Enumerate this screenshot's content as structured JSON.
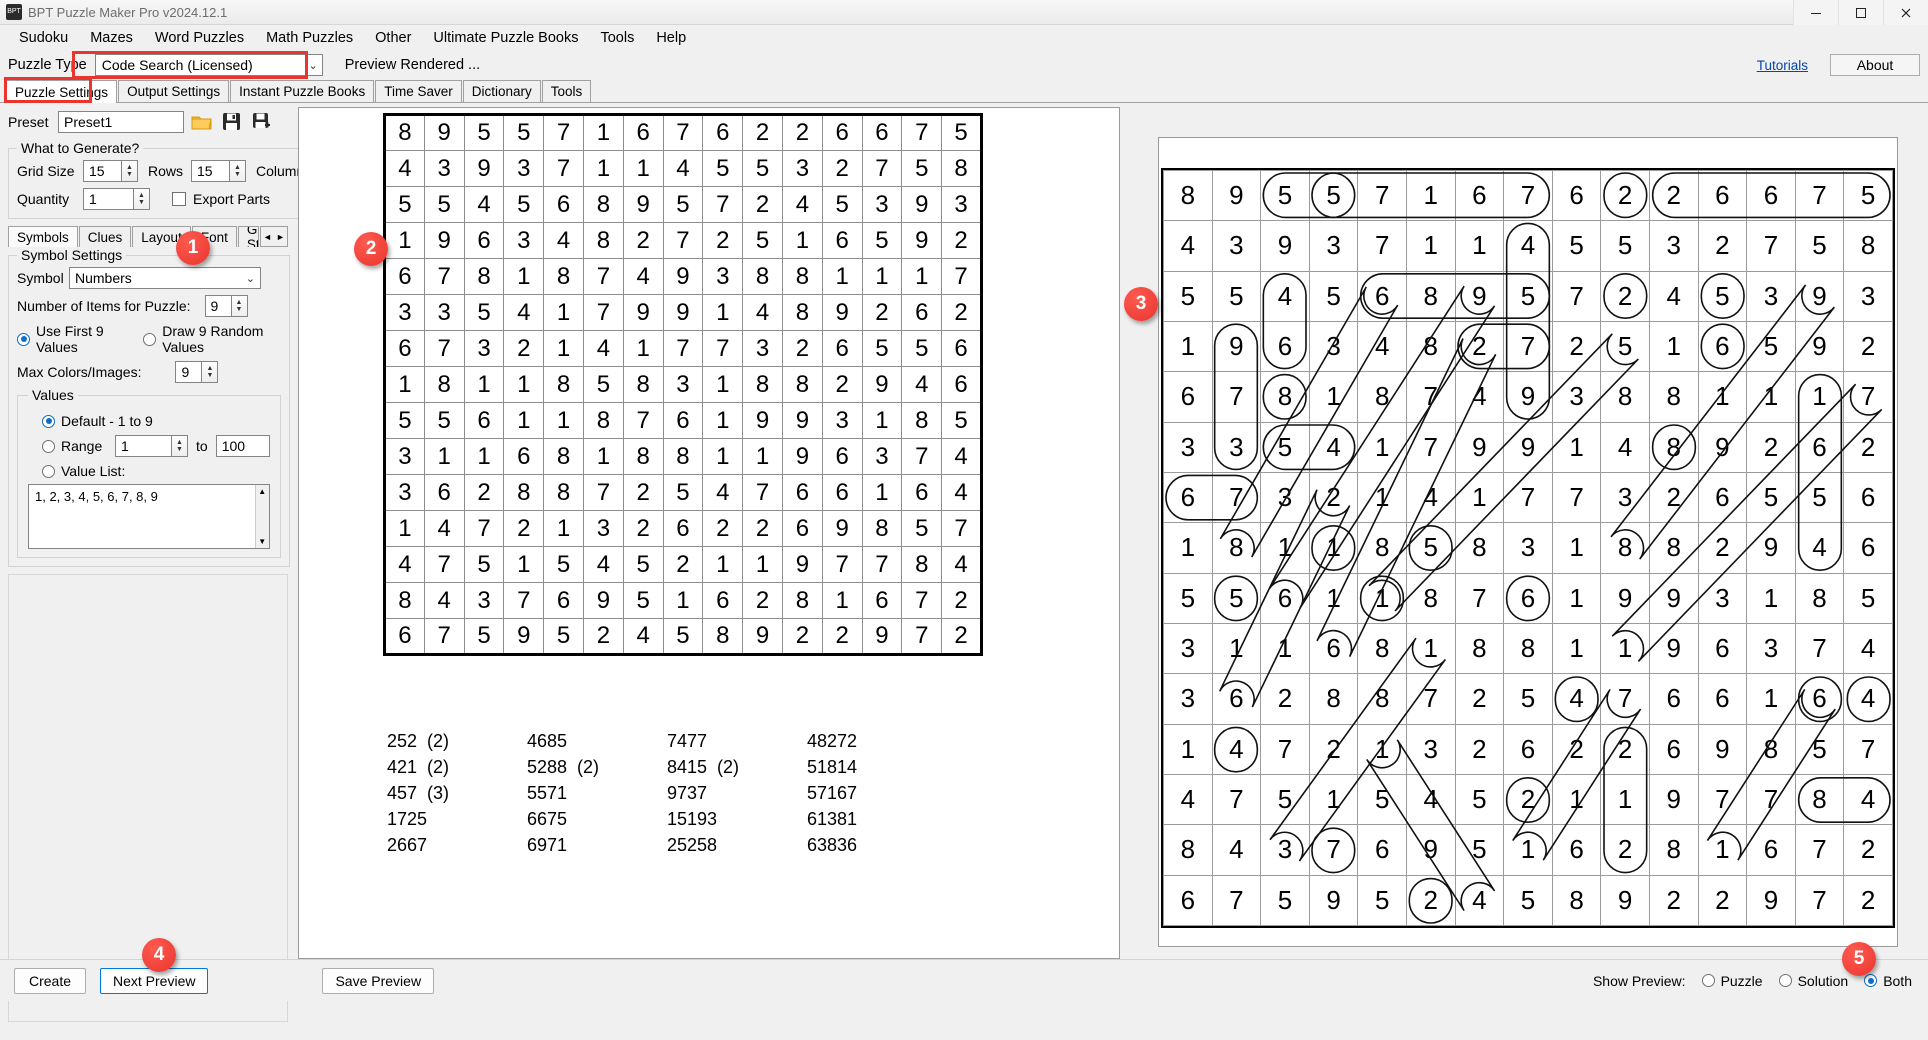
{
  "window": {
    "title": "BPT Puzzle Maker Pro v2024.12.1",
    "icon_label": "BPT",
    "buttons": {
      "minimize": "–",
      "maximize": "❐",
      "close": "✕"
    }
  },
  "menubar": {
    "items": [
      "Sudoku",
      "Mazes",
      "Word Puzzles",
      "Math Puzzles",
      "Other",
      "Ultimate Puzzle Books",
      "Tools",
      "Help"
    ]
  },
  "type_row": {
    "label": "Puzzle Type",
    "selected": "Code Search (Licensed)",
    "chevron": "⌄",
    "preview_rendered": "Preview Rendered ...",
    "tutorials": "Tutorials",
    "about": "About"
  },
  "tabs": {
    "items": [
      "Puzzle Settings",
      "Output Settings",
      "Instant Puzzle Books",
      "Time Saver",
      "Dictionary",
      "Tools"
    ],
    "active": "Puzzle Settings"
  },
  "settings": {
    "preset_label": "Preset",
    "preset_value": "Preset1",
    "icon_open": "open-folder-icon",
    "icon_save": "save-icon",
    "icon_save_as": "save-as-icon",
    "generate_legend": "What to Generate?",
    "grid_size_label": "Grid Size",
    "grid_size_value": "15",
    "rows_label": "Rows",
    "rows_value": "15",
    "columns_label": "Columns",
    "quantity_label": "Quantity",
    "quantity_value": "1",
    "export_parts_label": "Export Parts",
    "inner_tabs": [
      "Symbols",
      "Clues",
      "Layout",
      "Font",
      "Grid Styling"
    ],
    "inner_active": "Symbols",
    "scroll_left": "◄",
    "scroll_right": "►",
    "symbol_legend": "Symbol Settings",
    "symbol_label": "Symbol",
    "symbol_value": "Numbers",
    "items_label": "Number of Items for Puzzle:",
    "items_value": "9",
    "use_first_label": "Use First 9 Values",
    "draw_random_label": "Draw 9 Random Values",
    "max_colors_label": "Max Colors/Images:",
    "max_colors_value": "9",
    "values_legend": "Values",
    "default_label": "Default - 1 to 9",
    "range_label": "Range",
    "range_from": "1",
    "range_to_label": "to",
    "range_to": "100",
    "value_list_label": "Value List:",
    "value_list_value": "1, 2, 3, 4, 5, 6, 7, 8, 9"
  },
  "puzzle": {
    "grid": [
      [
        "8",
        "9",
        "5",
        "5",
        "7",
        "1",
        "6",
        "7",
        "6",
        "2",
        "2",
        "6",
        "6",
        "7",
        "5"
      ],
      [
        "4",
        "3",
        "9",
        "3",
        "7",
        "1",
        "1",
        "4",
        "5",
        "5",
        "3",
        "2",
        "7",
        "5",
        "8"
      ],
      [
        "5",
        "5",
        "4",
        "5",
        "6",
        "8",
        "9",
        "5",
        "7",
        "2",
        "4",
        "5",
        "3",
        "9",
        "3"
      ],
      [
        "1",
        "9",
        "6",
        "3",
        "4",
        "8",
        "2",
        "7",
        "2",
        "5",
        "1",
        "6",
        "5",
        "9",
        "2"
      ],
      [
        "6",
        "7",
        "8",
        "1",
        "8",
        "7",
        "4",
        "9",
        "3",
        "8",
        "8",
        "1",
        "1",
        "1",
        "7"
      ],
      [
        "3",
        "3",
        "5",
        "4",
        "1",
        "7",
        "9",
        "9",
        "1",
        "4",
        "8",
        "9",
        "2",
        "6",
        "2"
      ],
      [
        "6",
        "7",
        "3",
        "2",
        "1",
        "4",
        "1",
        "7",
        "7",
        "3",
        "2",
        "6",
        "5",
        "5",
        "6"
      ],
      [
        "1",
        "8",
        "1",
        "1",
        "8",
        "5",
        "8",
        "3",
        "1",
        "8",
        "8",
        "2",
        "9",
        "4",
        "6"
      ],
      [
        "5",
        "5",
        "6",
        "1",
        "1",
        "8",
        "7",
        "6",
        "1",
        "9",
        "9",
        "3",
        "1",
        "8",
        "5"
      ],
      [
        "3",
        "1",
        "1",
        "6",
        "8",
        "1",
        "8",
        "8",
        "1",
        "1",
        "9",
        "6",
        "3",
        "7",
        "4"
      ],
      [
        "3",
        "6",
        "2",
        "8",
        "8",
        "7",
        "2",
        "5",
        "4",
        "7",
        "6",
        "6",
        "1",
        "6",
        "4"
      ],
      [
        "1",
        "4",
        "7",
        "2",
        "1",
        "3",
        "2",
        "6",
        "2",
        "2",
        "6",
        "9",
        "8",
        "5",
        "7"
      ],
      [
        "4",
        "7",
        "5",
        "1",
        "5",
        "4",
        "5",
        "2",
        "1",
        "1",
        "9",
        "7",
        "7",
        "8",
        "4"
      ],
      [
        "8",
        "4",
        "3",
        "7",
        "6",
        "9",
        "5",
        "1",
        "6",
        "2",
        "8",
        "1",
        "6",
        "7",
        "2"
      ],
      [
        "6",
        "7",
        "5",
        "9",
        "5",
        "2",
        "4",
        "5",
        "8",
        "9",
        "2",
        "2",
        "9",
        "7",
        "2"
      ]
    ],
    "clue_columns": [
      [
        "252  (2)",
        "421  (2)",
        "457  (3)",
        "1725",
        "2667"
      ],
      [
        "4685",
        "5288  (2)",
        "5571",
        "6675",
        "6971"
      ],
      [
        "7477",
        "8415  (2)",
        "9737",
        "15193",
        "25258"
      ],
      [
        "48272",
        "51814",
        "57167",
        "61381",
        "63836"
      ]
    ]
  },
  "solution": {
    "grid": [
      [
        "8",
        "9",
        "5",
        "5",
        "7",
        "1",
        "6",
        "7",
        "6",
        "2",
        "2",
        "6",
        "6",
        "7",
        "5"
      ],
      [
        "4",
        "3",
        "9",
        "3",
        "7",
        "1",
        "1",
        "4",
        "5",
        "5",
        "3",
        "2",
        "7",
        "5",
        "8"
      ],
      [
        "5",
        "5",
        "4",
        "5",
        "6",
        "8",
        "9",
        "5",
        "7",
        "2",
        "4",
        "5",
        "3",
        "9",
        "3"
      ],
      [
        "1",
        "9",
        "6",
        "3",
        "4",
        "8",
        "2",
        "7",
        "2",
        "5",
        "1",
        "6",
        "5",
        "9",
        "2"
      ],
      [
        "6",
        "7",
        "8",
        "1",
        "8",
        "7",
        "4",
        "9",
        "3",
        "8",
        "8",
        "1",
        "1",
        "1",
        "7"
      ],
      [
        "3",
        "3",
        "5",
        "4",
        "1",
        "7",
        "9",
        "9",
        "1",
        "4",
        "8",
        "9",
        "2",
        "6",
        "2"
      ],
      [
        "6",
        "7",
        "3",
        "2",
        "1",
        "4",
        "1",
        "7",
        "7",
        "3",
        "2",
        "6",
        "5",
        "5",
        "6"
      ],
      [
        "1",
        "8",
        "1",
        "1",
        "8",
        "5",
        "8",
        "3",
        "1",
        "8",
        "8",
        "2",
        "9",
        "4",
        "6"
      ],
      [
        "5",
        "5",
        "6",
        "1",
        "1",
        "8",
        "7",
        "6",
        "1",
        "9",
        "9",
        "3",
        "1",
        "8",
        "5"
      ],
      [
        "3",
        "1",
        "1",
        "6",
        "8",
        "1",
        "8",
        "8",
        "1",
        "1",
        "9",
        "6",
        "3",
        "7",
        "4"
      ],
      [
        "3",
        "6",
        "2",
        "8",
        "8",
        "7",
        "2",
        "5",
        "4",
        "7",
        "6",
        "6",
        "1",
        "6",
        "4"
      ],
      [
        "1",
        "4",
        "7",
        "2",
        "1",
        "3",
        "2",
        "6",
        "2",
        "2",
        "6",
        "9",
        "8",
        "5",
        "7"
      ],
      [
        "4",
        "7",
        "5",
        "1",
        "5",
        "4",
        "5",
        "2",
        "1",
        "1",
        "9",
        "7",
        "7",
        "8",
        "4"
      ],
      [
        "8",
        "4",
        "3",
        "7",
        "6",
        "9",
        "5",
        "1",
        "6",
        "2",
        "8",
        "1",
        "6",
        "7",
        "2"
      ],
      [
        "6",
        "7",
        "5",
        "9",
        "5",
        "2",
        "4",
        "5",
        "8",
        "9",
        "2",
        "2",
        "9",
        "7",
        "2"
      ]
    ],
    "marks": [
      {
        "r1": 0,
        "c1": 2,
        "r2": 0,
        "c2": 3
      },
      {
        "r1": 0,
        "c1": 3,
        "r2": 0,
        "c2": 7
      },
      {
        "r1": 0,
        "c1": 9,
        "r2": 0,
        "c2": 9
      },
      {
        "r1": 0,
        "c1": 10,
        "r2": 0,
        "c2": 14
      },
      {
        "r1": 1,
        "c1": 7,
        "r2": 4,
        "c2": 7
      },
      {
        "r1": 2,
        "c1": 2,
        "r2": 3,
        "c2": 2
      },
      {
        "r1": 2,
        "c1": 4,
        "r2": 2,
        "c2": 7
      },
      {
        "r1": 2,
        "c1": 9,
        "r2": 2,
        "c2": 9
      },
      {
        "r1": 2,
        "c1": 11,
        "r2": 2,
        "c2": 11
      },
      {
        "r1": 3,
        "c1": 1,
        "r2": 5,
        "c2": 1
      },
      {
        "r1": 3,
        "c1": 6,
        "r2": 3,
        "c2": 7
      },
      {
        "r1": 3,
        "c1": 11,
        "r2": 3,
        "c2": 11
      },
      {
        "r1": 4,
        "c1": 2,
        "r2": 4,
        "c2": 2
      },
      {
        "r1": 4,
        "c1": 13,
        "r2": 7,
        "c2": 13
      },
      {
        "r1": 5,
        "c1": 2,
        "r2": 5,
        "c2": 3
      },
      {
        "r1": 5,
        "c1": 10,
        "r2": 5,
        "c2": 10
      },
      {
        "r1": 6,
        "c1": 0,
        "r2": 6,
        "c2": 1
      },
      {
        "r1": 7,
        "c1": 3,
        "r2": 7,
        "c2": 3
      },
      {
        "r1": 7,
        "c1": 5,
        "r2": 7,
        "c2": 5
      },
      {
        "r1": 8,
        "c1": 1,
        "r2": 8,
        "c2": 1
      },
      {
        "r1": 8,
        "c1": 4,
        "r2": 8,
        "c2": 4
      },
      {
        "r1": 8,
        "c1": 7,
        "r2": 8,
        "c2": 7
      },
      {
        "r1": 10,
        "c1": 8,
        "r2": 10,
        "c2": 8
      },
      {
        "r1": 10,
        "c1": 13,
        "r2": 10,
        "c2": 13
      },
      {
        "r1": 10,
        "c1": 14,
        "r2": 10,
        "c2": 14
      },
      {
        "r1": 11,
        "c1": 1,
        "r2": 11,
        "c2": 1
      },
      {
        "r1": 11,
        "c1": 9,
        "r2": 13,
        "c2": 9
      },
      {
        "r1": 12,
        "c1": 7,
        "r2": 12,
        "c2": 7
      },
      {
        "r1": 12,
        "c1": 13,
        "r2": 12,
        "c2": 14
      },
      {
        "r1": 13,
        "c1": 3,
        "r2": 13,
        "c2": 3
      },
      {
        "r1": 14,
        "c1": 5,
        "r2": 14,
        "c2": 5
      }
    ],
    "diagonals": [
      {
        "r1": 2,
        "c1": 4,
        "r2": 7,
        "c2": 1
      },
      {
        "r1": 2,
        "c1": 6,
        "r2": 8,
        "c2": 2
      },
      {
        "r1": 3,
        "c1": 6,
        "r2": 9,
        "c2": 3
      },
      {
        "r1": 3,
        "c1": 9,
        "r2": 8,
        "c2": 4
      },
      {
        "r1": 2,
        "c1": 13,
        "r2": 7,
        "c2": 9
      },
      {
        "r1": 4,
        "c1": 14,
        "r2": 9,
        "c2": 9
      },
      {
        "r1": 6,
        "c1": 3,
        "r2": 10,
        "c2": 1
      },
      {
        "r1": 9,
        "c1": 5,
        "r2": 13,
        "c2": 2
      },
      {
        "r1": 10,
        "c1": 9,
        "r2": 13,
        "c2": 7
      },
      {
        "r1": 10,
        "c1": 13,
        "r2": 13,
        "c2": 11
      },
      {
        "r1": 11,
        "c1": 4,
        "r2": 14,
        "c2": 6
      }
    ]
  },
  "bottom": {
    "create": "Create",
    "next_preview": "Next Preview",
    "save_preview": "Save Preview",
    "show_preview_label": "Show Preview:",
    "opt_puzzle": "Puzzle",
    "opt_solution": "Solution",
    "opt_both": "Both",
    "selected": "Both"
  },
  "badges": [
    "1",
    "2",
    "3",
    "4",
    "5"
  ],
  "colors": {
    "accent_red": "#e8352e",
    "radio_blue": "#0b6fc9",
    "link_blue": "#0645ad",
    "folder_orange": "#f5b942"
  }
}
